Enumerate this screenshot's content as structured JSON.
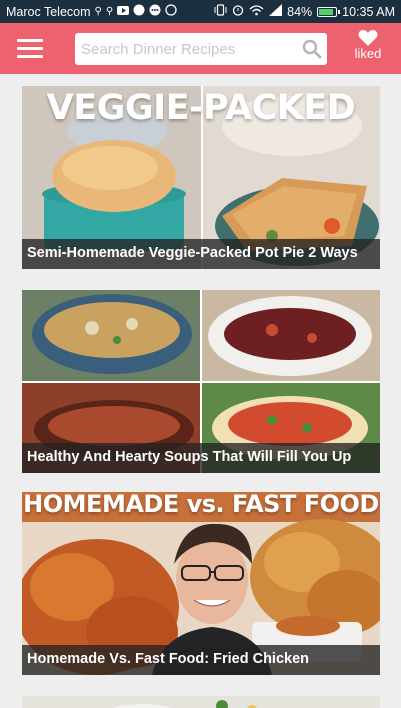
{
  "status_bar": {
    "carrier": "Maroc Telecom",
    "battery": "84%",
    "time": "10:35 AM",
    "icons": [
      "usb-icon",
      "usb-icon",
      "youtube-icon",
      "ted-icon",
      "dots-icon",
      "whatsapp-icon",
      "vibrate-icon",
      "alarm-icon",
      "wifi-icon",
      "signal-icon",
      "battery-icon"
    ]
  },
  "app_bar": {
    "search_placeholder": "Search Dinner Recipes",
    "liked_label": "liked",
    "background": "#ee6270"
  },
  "feed": {
    "cards": [
      {
        "overlay_text": "VEGGIE-PACKED",
        "caption": "Semi-Homemade Veggie-Packed Pot Pie 2 Ways"
      },
      {
        "overlay_text": "",
        "caption": "Healthy And Hearty Soups That Will Fill You Up"
      },
      {
        "overlay_text": "HOMEMADE vs. FAST FOOD",
        "caption": "Homemade Vs. Fast Food: Fried Chicken"
      }
    ]
  }
}
